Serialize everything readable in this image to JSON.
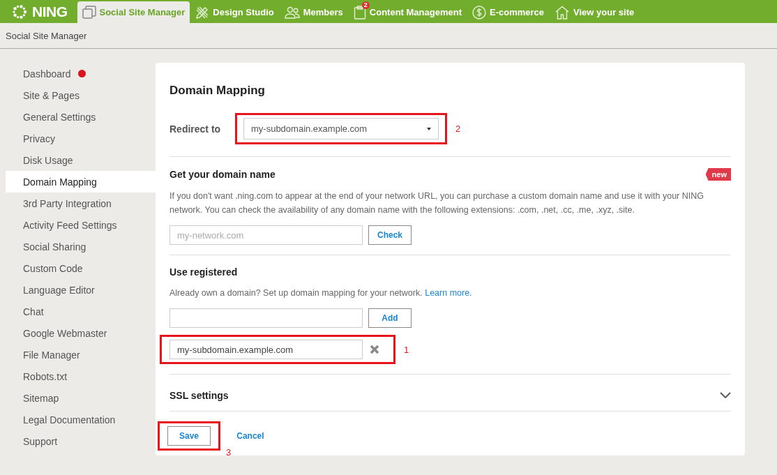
{
  "nav": {
    "logo": "NING",
    "tabs": [
      {
        "label": "Social Site Manager",
        "selected": true
      },
      {
        "label": "Design Studio",
        "selected": false
      },
      {
        "label": "Members",
        "selected": false
      },
      {
        "label": "Content Management",
        "selected": false,
        "badge": "2"
      },
      {
        "label": "E-commerce",
        "selected": false
      },
      {
        "label": "View your site",
        "selected": false
      }
    ]
  },
  "breadcrumb": "Social Site Manager",
  "sidebar": {
    "items": [
      {
        "label": "Dashboard",
        "selected": false,
        "notification": true
      },
      {
        "label": "Site & Pages",
        "selected": false,
        "notification": false
      },
      {
        "label": "General Settings",
        "selected": false,
        "notification": false
      },
      {
        "label": "Privacy",
        "selected": false,
        "notification": false
      },
      {
        "label": "Disk Usage",
        "selected": false,
        "notification": false
      },
      {
        "label": "Domain Mapping",
        "selected": true,
        "notification": false
      },
      {
        "label": "3rd Party Integration",
        "selected": false,
        "notification": false
      },
      {
        "label": "Activity Feed Settings",
        "selected": false,
        "notification": false
      },
      {
        "label": "Social Sharing",
        "selected": false,
        "notification": false
      },
      {
        "label": "Custom Code",
        "selected": false,
        "notification": false
      },
      {
        "label": "Language Editor",
        "selected": false,
        "notification": false
      },
      {
        "label": "Chat",
        "selected": false,
        "notification": false
      },
      {
        "label": "Google Webmaster",
        "selected": false,
        "notification": false
      },
      {
        "label": "File Manager",
        "selected": false,
        "notification": false
      },
      {
        "label": "Robots.txt",
        "selected": false,
        "notification": false
      },
      {
        "label": "Sitemap",
        "selected": false,
        "notification": false
      },
      {
        "label": "Legal Documentation",
        "selected": false,
        "notification": false
      },
      {
        "label": "Support",
        "selected": false,
        "notification": false
      }
    ]
  },
  "panel": {
    "title": "Domain Mapping",
    "redirect": {
      "label": "Redirect to",
      "value": "my-subdomain.example.com",
      "annotation": "2"
    },
    "get_domain": {
      "title": "Get your domain name",
      "badge": "new",
      "description": "If you don't want .ning.com to appear at the end of your network URL, you can purchase a custom domain name and use it with your NING network. You can check the availability of any domain name with the following extensions: .com, .net, .cc, .me, .xyz, .site.",
      "placeholder": "my-network.com",
      "button": "Check"
    },
    "use_registered": {
      "title": "Use registered",
      "description": "Already own a domain? Set up domain mapping for your network.",
      "link": "Learn more.",
      "button": "Add",
      "domains": [
        {
          "value": "my-subdomain.example.com",
          "annotation": "1"
        }
      ]
    },
    "ssl": {
      "title": "SSL settings",
      "expanded": false
    },
    "save": {
      "label": "Save",
      "annotation": "3"
    },
    "cancel": "Cancel"
  }
}
